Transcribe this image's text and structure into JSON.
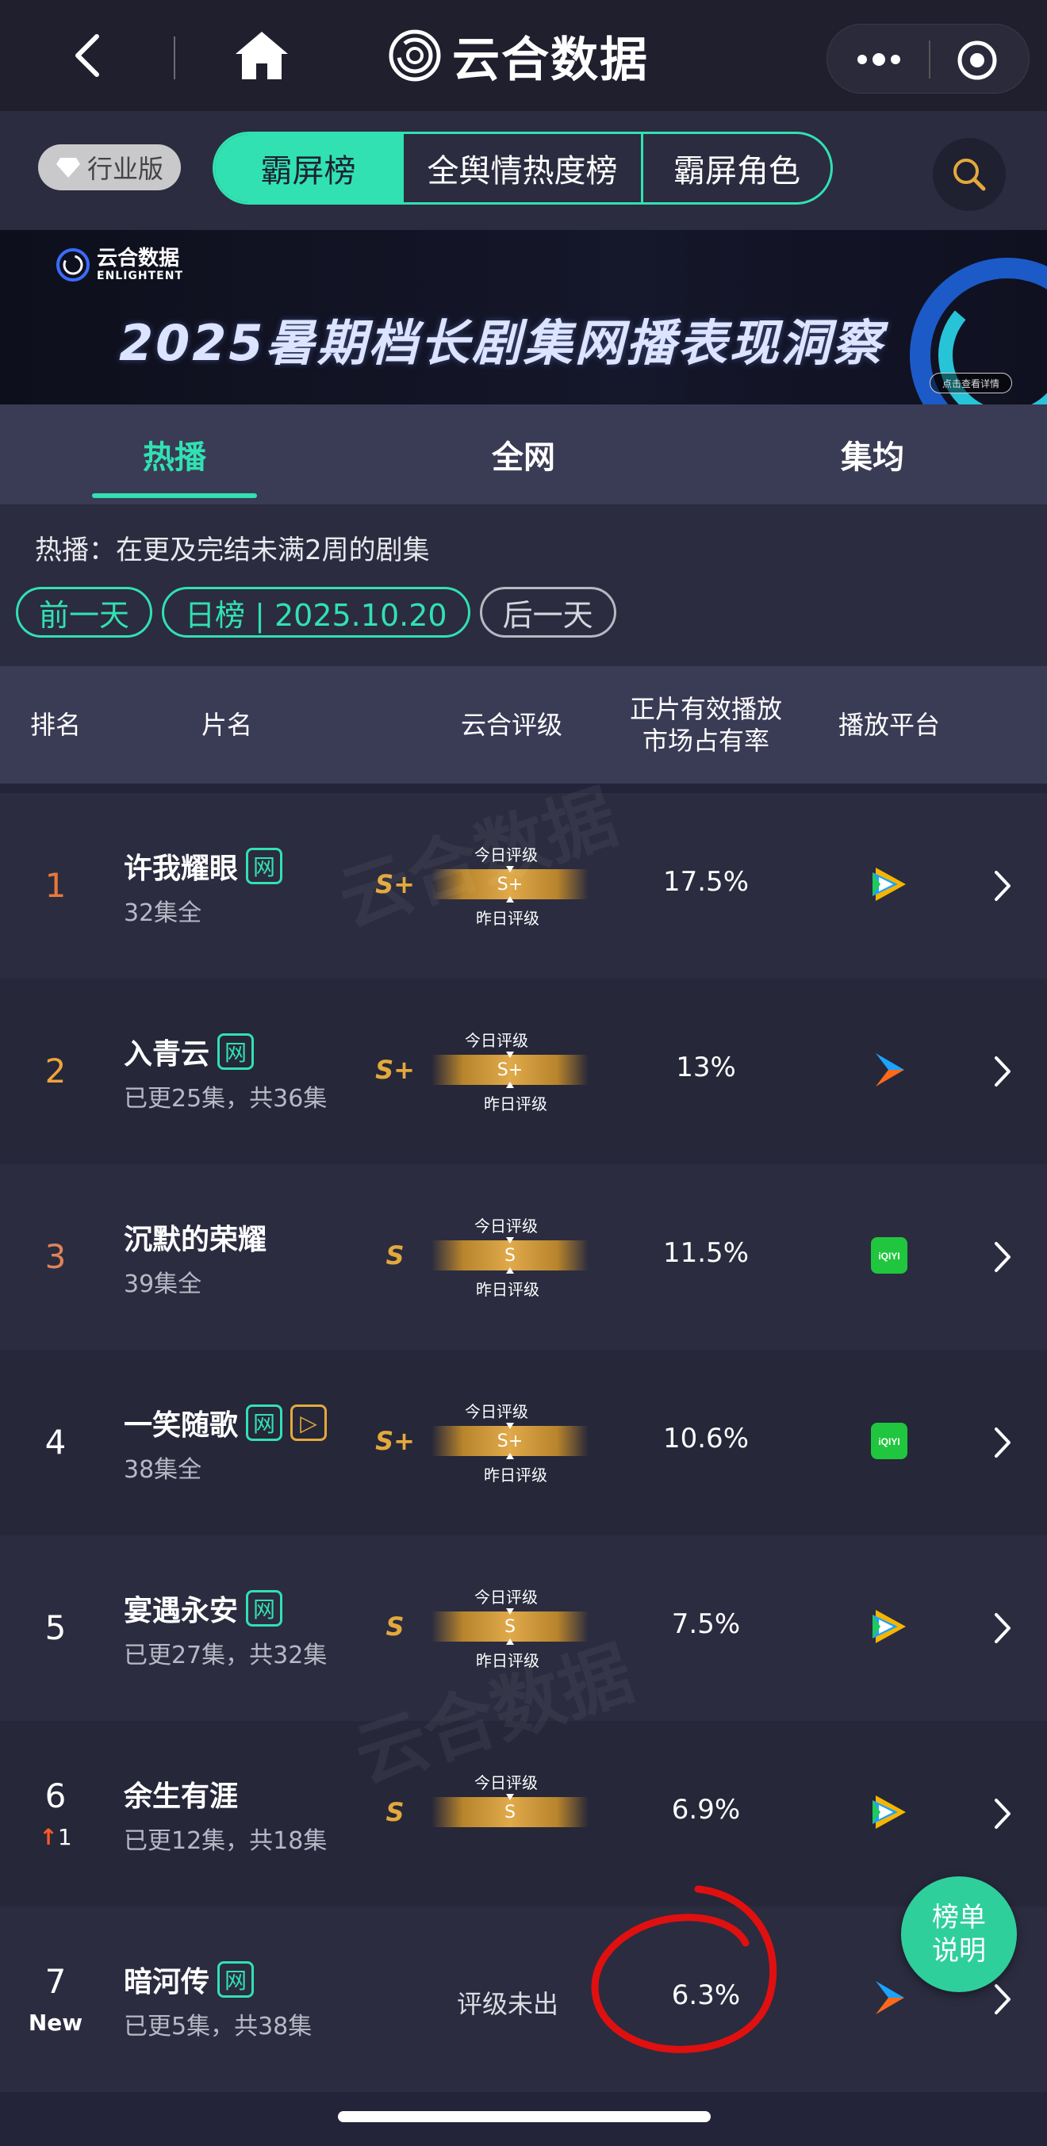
{
  "nav": {
    "brand_title": "云合数据",
    "icons": {
      "back": "chevron-left-icon",
      "home": "home-icon",
      "more": "more-dots-icon",
      "close": "mini-program-close-icon"
    }
  },
  "subhead": {
    "edition": "行业版",
    "tabs": [
      {
        "label": "霸屏榜",
        "active": true
      },
      {
        "label": "全舆情热度榜",
        "active": false
      },
      {
        "label": "霸屏角色",
        "active": false
      }
    ]
  },
  "banner": {
    "logo_cn": "云合数据",
    "logo_en": "ENLIGHTENT",
    "title": "2025暑期档长剧集网播表现洞察",
    "cta": "点击查看详情"
  },
  "subtabs": [
    {
      "label": "热播",
      "active": true
    },
    {
      "label": "全网",
      "active": false
    },
    {
      "label": "集均",
      "active": false
    }
  ],
  "info": {
    "hint": "热播：在更及完结未满2周的剧集",
    "prev_day": "前一天",
    "date": "日榜 | 2025.10.20",
    "next_day": "后一天"
  },
  "table": {
    "headers": {
      "rank": "排名",
      "title": "片名",
      "rating": "云合评级",
      "share_line1": "正片有效播放",
      "share_line2": "市场占有率",
      "platform": "播放平台"
    },
    "today_label": "今日评级",
    "yesterday_label": "昨日评级",
    "rows": [
      {
        "rank": "1",
        "title": "许我耀眼",
        "tags": [
          "网"
        ],
        "episodes": "32集全",
        "grade": "S+",
        "bar_grade": "S+",
        "has_yesterday": true,
        "share": "17.5%",
        "platform": "tencent-video-icon",
        "rank_color": "#e8793a"
      },
      {
        "rank": "2",
        "title": "入青云",
        "tags": [
          "网"
        ],
        "episodes": "已更25集，共36集",
        "grade": "S+",
        "bar_grade": "S+",
        "has_yesterday": true,
        "share": "13%",
        "platform": "youku-icon",
        "rank_color": "#f0a33a"
      },
      {
        "rank": "3",
        "title": "沉默的荣耀",
        "tags": [],
        "episodes": "39集全",
        "grade": "S",
        "bar_grade": "S",
        "has_yesterday": true,
        "share": "11.5%",
        "platform": "iqiyi-icon",
        "rank_color": "#e08358"
      },
      {
        "rank": "4",
        "title": "一笑随歌",
        "tags": [
          "网",
          "▷"
        ],
        "episodes": "38集全",
        "grade": "S+",
        "bar_grade": "S+",
        "has_yesterday": true,
        "share": "10.6%",
        "platform": "iqiyi-icon",
        "rank_color": "#ffffff"
      },
      {
        "rank": "5",
        "title": "宴遇永安",
        "tags": [
          "网"
        ],
        "episodes": "已更27集，共32集",
        "grade": "S",
        "bar_grade": "S",
        "has_yesterday": true,
        "share": "7.5%",
        "platform": "tencent-video-icon",
        "rank_color": "#ffffff"
      },
      {
        "rank": "6",
        "rank_change": "1",
        "title": "余生有涯",
        "tags": [],
        "episodes": "已更12集，共18集",
        "grade": "S",
        "bar_grade": "S",
        "has_yesterday": false,
        "share": "6.9%",
        "platform": "tencent-video-icon",
        "rank_color": "#ffffff"
      },
      {
        "rank": "7",
        "rank_sub": "New",
        "title": "暗河传",
        "tags": [
          "网"
        ],
        "episodes": "已更5集，共38集",
        "grade": "",
        "no_grade": "评级未出",
        "share": "6.3%",
        "platform": "youku-icon",
        "rank_color": "#ffffff"
      }
    ]
  },
  "float_button": {
    "line1": "榜单",
    "line2": "说明"
  },
  "colors": {
    "accent": "#31e1b2",
    "gold": "#e3a93c",
    "bg": "#23243a",
    "annotation": "#e01010"
  }
}
